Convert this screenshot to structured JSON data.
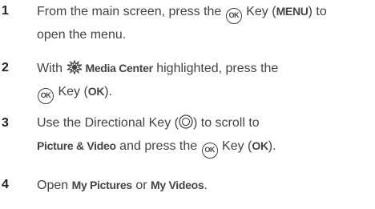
{
  "steps": [
    {
      "number": "1",
      "line1_a": "From the main screen, press the",
      "line1_b": "Key (",
      "line1_kw": "MENU",
      "line1_c": ") to",
      "line2": "open the menu.",
      "ok_icon_text": "OK"
    },
    {
      "number": "2",
      "line1_a": "With",
      "line1_kw": "Media Center",
      "line1_b": "highlighted, press the",
      "line2_b": "Key (",
      "line2_kw": "OK",
      "line2_c": ").",
      "ok_icon_text": "OK",
      "icon": "media-center-icon"
    },
    {
      "number": "3",
      "line1_a": "Use the Directional Key (",
      "line1_c": ") to scroll to",
      "line2_kw": "Picture & Video",
      "line2_a": "and press the",
      "line2_b": "Key (",
      "line2_kw2": "OK",
      "line2_c": ").",
      "ok_icon_text": "OK",
      "icon": "directional-key-icon"
    },
    {
      "number": "4",
      "line1_a": "Open",
      "line1_kw": "My Pictures",
      "line1_b": "or",
      "line1_kw2": "My Videos",
      "line1_c": "."
    }
  ]
}
